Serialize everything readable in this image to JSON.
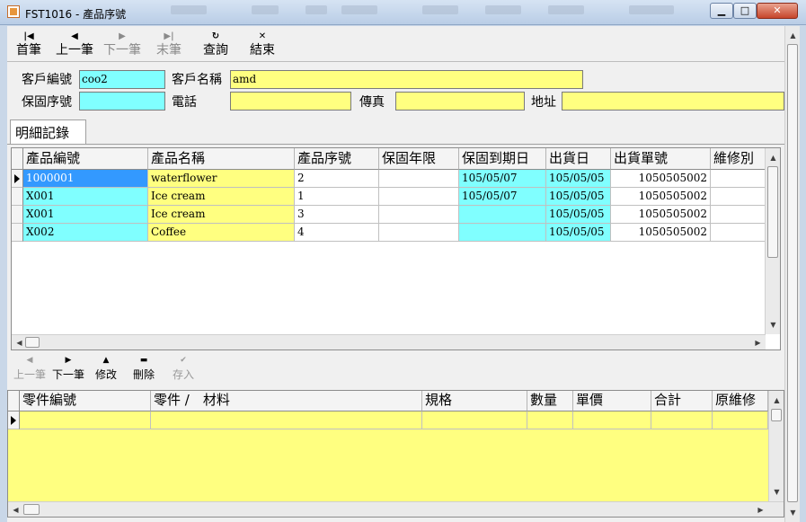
{
  "window": {
    "title": "FST1016 - 產品序號",
    "min_glyph": "▁",
    "max_glyph": "□",
    "close_glyph": "✕"
  },
  "toolbar": {
    "first": {
      "label": "首筆",
      "icon": "skip-first-icon",
      "glyph": "|◀"
    },
    "prev": {
      "label": "上一筆",
      "icon": "prev-icon",
      "glyph": "◀"
    },
    "next": {
      "label": "下一筆",
      "icon": "next-icon",
      "glyph": "▶"
    },
    "last": {
      "label": "末筆",
      "icon": "skip-last-icon",
      "glyph": "▶|"
    },
    "query": {
      "label": "查詢",
      "icon": "refresh-icon",
      "glyph": "↻"
    },
    "exit": {
      "label": "結束",
      "icon": "close-icon",
      "glyph": "✕"
    }
  },
  "header": {
    "customer_no_label": "客戶編號",
    "customer_no_value": "coo2",
    "customer_name_label": "客戶名稱",
    "customer_name_value": "amd",
    "warranty_no_label": "保固序號",
    "warranty_no_value": "",
    "phone_label": "電話",
    "phone_value": "",
    "fax_label": "傳真",
    "fax_value": "",
    "address_label": "地址",
    "address_value": ""
  },
  "tab": {
    "label": "明細記錄"
  },
  "detail_grid": {
    "columns": [
      "產品編號",
      "產品名稱",
      "產品序號",
      "保固年限",
      "保固到期日",
      "出貨日",
      "出貨單號",
      "維修別"
    ],
    "rows": [
      [
        "1000001",
        "waterflower",
        "2",
        "",
        "105/05/07",
        "105/05/05",
        "1050505002",
        ""
      ],
      [
        "X001",
        "Ice cream",
        "1",
        "",
        "105/05/07",
        "105/05/05",
        "1050505002",
        ""
      ],
      [
        "X001",
        "Ice cream",
        "3",
        "",
        "",
        "105/05/05",
        "1050505002",
        ""
      ],
      [
        "X002",
        "Coffee",
        "4",
        "",
        "",
        "105/05/05",
        "1050505002",
        ""
      ]
    ]
  },
  "detail_nav": {
    "prev": {
      "label": "上一筆",
      "glyph": "◀"
    },
    "next": {
      "label": "下一筆",
      "glyph": "▶"
    },
    "edit": {
      "label": "修改",
      "glyph": "▲"
    },
    "delete": {
      "label": "刪除",
      "glyph": "▬"
    },
    "save": {
      "label": "存入",
      "glyph": "✔"
    }
  },
  "parts_grid": {
    "columns": [
      "零件編號",
      "零件 /　材料",
      "規格",
      "數量",
      "單價",
      "合計",
      "原維修"
    ]
  },
  "colors": {
    "cyan": "#80ffff",
    "yellow": "#ffff80",
    "selection": "#3399ff"
  }
}
